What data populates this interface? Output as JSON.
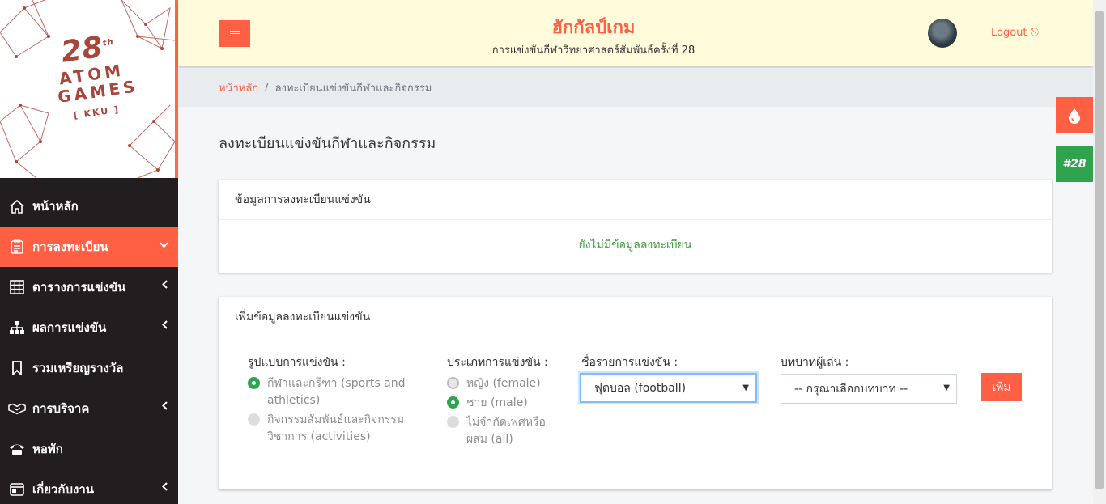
{
  "logo": {
    "number": "28",
    "sup": "th",
    "line1": "ATOM",
    "line2": "GAMES",
    "tag": "[ KKU ]"
  },
  "sidebar": {
    "items": [
      {
        "label": "หน้าหลัก",
        "icon": "home-icon",
        "chevron": ""
      },
      {
        "label": "การลงทะเบียน",
        "icon": "registration-icon",
        "chevron": "⌄"
      },
      {
        "label": "ตารางการแข่งขัน",
        "icon": "table-grid-icon",
        "chevron": "‹"
      },
      {
        "label": "ผลการแข่งขัน",
        "icon": "sitemap-icon",
        "chevron": "‹"
      },
      {
        "label": "รวมเหรียญรางวัล",
        "icon": "bookmark-icon",
        "chevron": ""
      },
      {
        "label": "การบริจาค",
        "icon": "handshake-icon",
        "chevron": "‹"
      },
      {
        "label": "หอพัก",
        "icon": "phone-icon",
        "chevron": ""
      },
      {
        "label": "เกี่ยวกับงาน",
        "icon": "window-icon",
        "chevron": "‹"
      }
    ]
  },
  "header": {
    "title": "ฮักกัลป์เกม",
    "subtitle": "การแข่งขันกีฬาวิทยาศาสตร์สัมพันธ์ครั้งที่ 28",
    "logout": "Logout ⎋"
  },
  "floating": {
    "badge": "#28"
  },
  "breadcrumb": {
    "home": "หน้าหลัก",
    "sep": "/",
    "current": "ลงทะเบียนแข่งขันกีฬาและกิจกรรม"
  },
  "page": {
    "title": "ลงทะเบียนแข่งขันกีฬาและกิจกรรม"
  },
  "registration_info": {
    "header": "ข้อมูลการลงทะเบียนแข่งขัน",
    "empty": "ยังไม่มีข้อมูลลงทะเบียน"
  },
  "add_form": {
    "header": "เพิ่มข้อมูลลงทะเบียนแข่งขัน",
    "format_label": "รูปแบบการแข่งขัน :",
    "format_options": [
      {
        "label": "กีฬาและกรีฑา (sports and athletics)",
        "line1": "กีฬาและกรีฑา (sports and",
        "line2": "athletics)",
        "checked": true
      },
      {
        "label": "กิจกรรมสัมพันธ์และกิจกรรมวิชาการ (activities)",
        "line1": "กิจกรรมสัมพันธ์และกิจกรรม",
        "line2": "วิชาการ (activities)",
        "checked": false
      }
    ],
    "type_label": "ประเภทการแข่งขัน :",
    "type_options": [
      {
        "line1": "หญิง (female)",
        "line2": "",
        "checked": false
      },
      {
        "line1": "ชาย (male)",
        "line2": "",
        "checked": true
      },
      {
        "line1": "ไม่จำกัดเพศหรือ",
        "line2": "ผสม (all)",
        "checked": false
      }
    ],
    "event_label": "ชื่อรายการแข่งขัน :",
    "event_value": "ฟุตบอล (football)",
    "role_label": "บทบาทผู้เล่น :",
    "role_value": "-- กรุณาเลือกบทบาท --",
    "add_button": "เพิ่ม"
  },
  "colors": {
    "accent": "#ff5f43",
    "sidebar": "#221e1f",
    "topbar": "#fffbdb",
    "green": "#2fa34d"
  }
}
